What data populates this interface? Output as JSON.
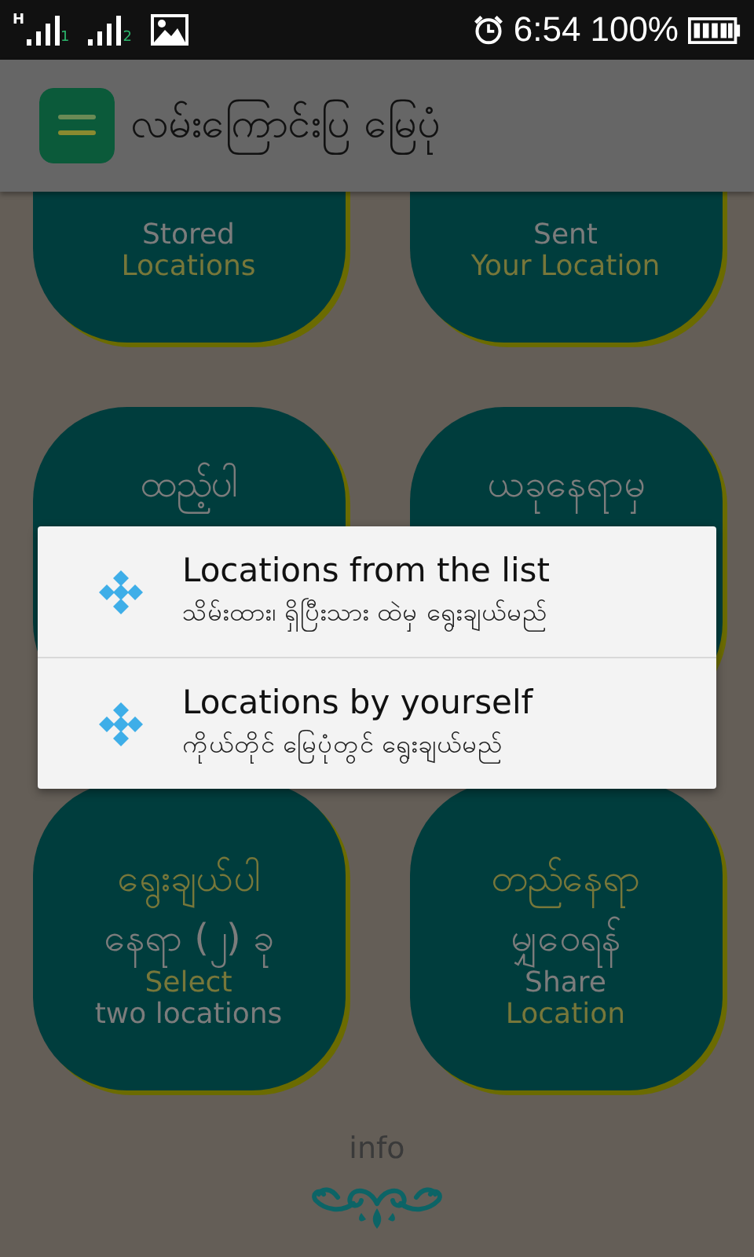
{
  "status_bar": {
    "sim_1": {
      "network": "H",
      "slot": "1"
    },
    "sim_2": {
      "slot": "2"
    },
    "time": "6:54",
    "battery": "100%"
  },
  "app_bar": {
    "title": "လမ်းကြောင်းပြ မြေပုံ"
  },
  "tiles": [
    {
      "lines": [
        {
          "text": "Stored",
          "color": "#7c7c7c"
        },
        {
          "text": "Locations",
          "color": "#77773a"
        }
      ]
    },
    {
      "lines": [
        {
          "text": "Sent",
          "color": "#7c7c7c"
        },
        {
          "text": "Your Location",
          "color": "#77773a"
        }
      ]
    },
    {
      "lines": [
        {
          "text": "ထည့်ပါ",
          "color": "#7c7c7c"
        }
      ]
    },
    {
      "lines": [
        {
          "text": "ယခုနေရာမှ",
          "color": "#7c7c7c"
        }
      ]
    },
    {
      "lines": [
        {
          "text": "ရွေးချယ်ပါ",
          "color": "#77773a"
        },
        {
          "text": "နေရာ (၂) ခု",
          "color": "#7c7c7c"
        },
        {
          "text": "Select",
          "color": "#77773a"
        },
        {
          "text": "two locations",
          "color": "#7c7c7c"
        }
      ]
    },
    {
      "lines": [
        {
          "text": "တည်နေရာ",
          "color": "#77773a"
        },
        {
          "text": "မျှဝေရန်",
          "color": "#7c7c7c"
        },
        {
          "text": "Share",
          "color": "#7c7c7c"
        },
        {
          "text": "Location",
          "color": "#77773a"
        }
      ]
    }
  ],
  "footer": {
    "label": "info"
  },
  "dialog": {
    "items": [
      {
        "title": "Locations from the list",
        "subtitle": "သိမ်းထား၊ ရှိပြီးသား ထဲမှ ရွေးချယ်မည်"
      },
      {
        "title": "Locations by yourself",
        "subtitle": "ကိုယ်တိုင် မြေပုံတွင် ရွေးချယ်မည်"
      }
    ]
  }
}
